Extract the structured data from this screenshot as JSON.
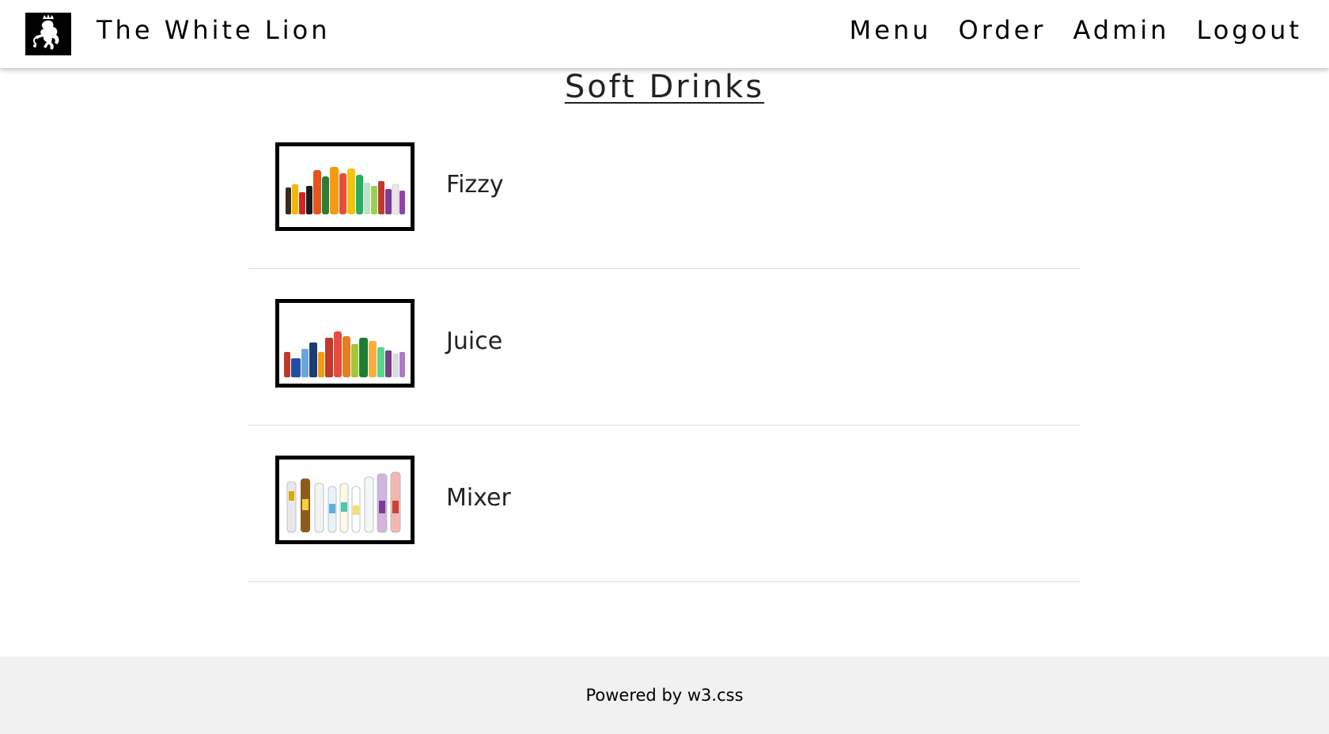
{
  "header": {
    "brand": "The White Lion",
    "logo_icon": "white-lion-icon",
    "nav": [
      {
        "label": "Menu"
      },
      {
        "label": "Order"
      },
      {
        "label": "Admin"
      },
      {
        "label": "Logout"
      }
    ]
  },
  "main": {
    "title": "Soft Drinks",
    "categories": [
      {
        "label": "Fizzy",
        "image": "fizzy-drinks-bottles"
      },
      {
        "label": "Juice",
        "image": "juice-drinks-bottles"
      },
      {
        "label": "Mixer",
        "image": "mixer-drinks-bottles"
      }
    ]
  },
  "footer": {
    "text": "Powered by w3.css"
  },
  "colors": {
    "topbar_bg": "#ffffff",
    "footer_bg": "#f1f1f1",
    "text": "#222222",
    "thumb_border": "#000000"
  }
}
